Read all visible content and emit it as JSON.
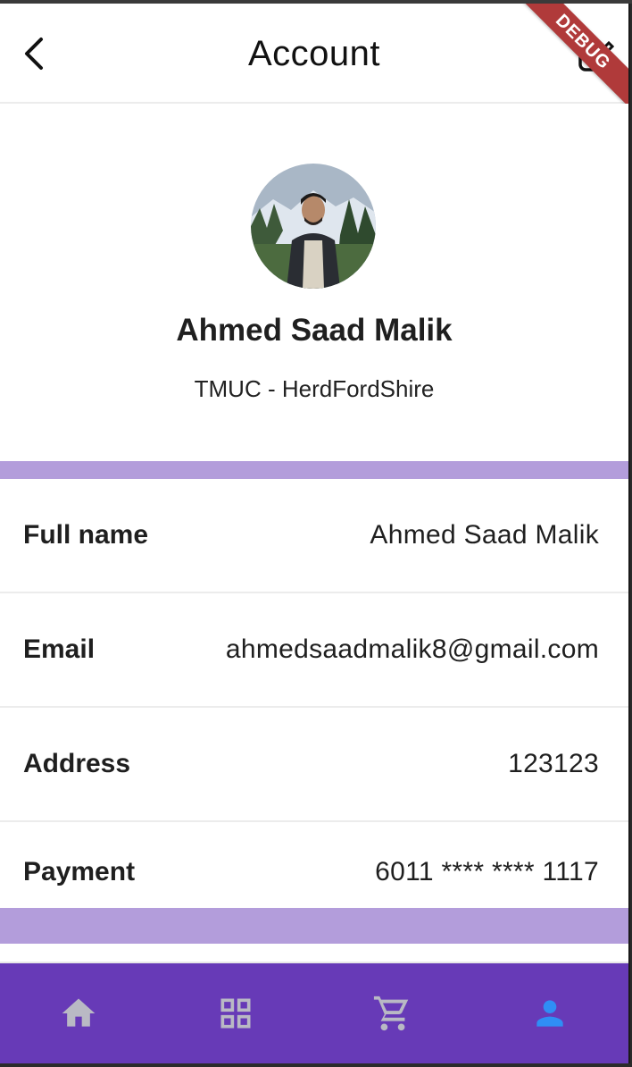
{
  "app_bar": {
    "title": "Account",
    "debug_label": "DEBUG"
  },
  "profile": {
    "name": "Ahmed Saad Malik",
    "subtitle": "TMUC - HerdFordShire"
  },
  "info_rows": [
    {
      "label": "Full name",
      "value": "Ahmed Saad Malik"
    },
    {
      "label": "Email",
      "value": "ahmedsaadmalik8@gmail.com"
    },
    {
      "label": "Address",
      "value": "123123"
    },
    {
      "label": "Payment",
      "value": "6011 **** **** 1117"
    }
  ],
  "bottom_nav": {
    "items": [
      {
        "icon": "home-icon",
        "active": false
      },
      {
        "icon": "grid-icon",
        "active": false
      },
      {
        "icon": "cart-icon",
        "active": false
      },
      {
        "icon": "person-icon",
        "active": true
      }
    ]
  },
  "colors": {
    "accent": "#673ab7",
    "band": "#b39ddb",
    "inactive_icon": "#b9b9c4",
    "active_icon": "#2f8ef5",
    "debug_banner": "#b03a3a"
  }
}
